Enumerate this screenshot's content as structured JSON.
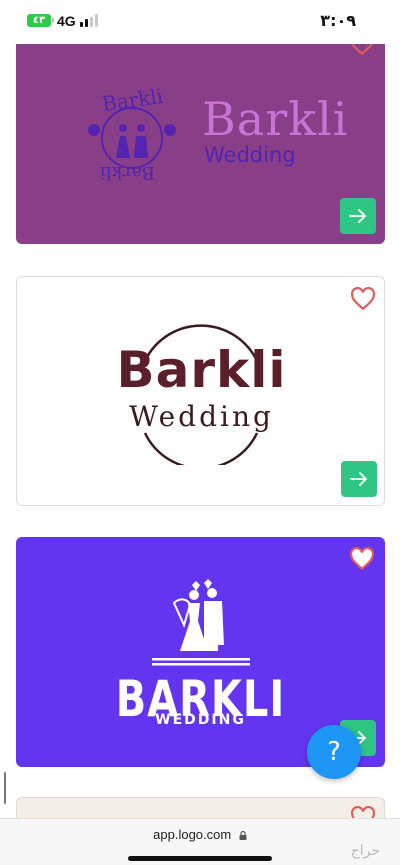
{
  "status_bar": {
    "battery": "٤٣",
    "network": "4G",
    "time": "٣:٠٩"
  },
  "cards": [
    {
      "logo_name": "Barkli",
      "logo_tagline": "Wedding",
      "seal_text": "Barkli",
      "seal_text_bottom": "Barkli",
      "background": "#883f88",
      "favorite_icon": "heart-outline-icon",
      "open_icon": "arrow-right-icon"
    },
    {
      "logo_name": "Barkli",
      "logo_tagline": "Wedding",
      "background": "#ffffff",
      "favorite_icon": "heart-outline-icon",
      "open_icon": "arrow-right-icon"
    },
    {
      "logo_name": "BARKLI",
      "logo_tagline": "WEDDING",
      "background": "#6435f0",
      "favorite_icon": "heart-outline-icon",
      "open_icon": "arrow-right-icon"
    },
    {
      "background": "#f3efe7",
      "favorite_icon": "heart-outline-icon"
    }
  ],
  "help_button": {
    "label": "?",
    "color": "#1e96f5"
  },
  "browser": {
    "url": "app.logo.com",
    "lock_icon": "lock-icon"
  },
  "watermark": "حراج",
  "colors": {
    "accent_green": "#2fc584",
    "heart": "#e05a5a"
  }
}
